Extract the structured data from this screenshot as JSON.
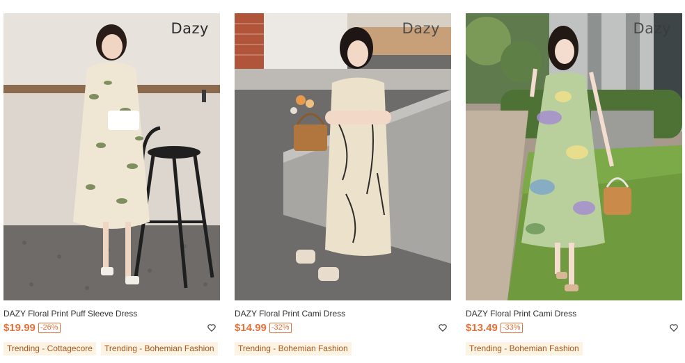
{
  "products": [
    {
      "brand_mark": "Dazy",
      "title": "DAZY Floral Print Puff Sleeve Dress",
      "price": "$19.99",
      "discount": "-26%",
      "tags": [
        "Trending - Cottagecore",
        "Trending - Bohemian Fashion"
      ],
      "wishlist_icon": "heart-outline-icon"
    },
    {
      "brand_mark": "Dazy",
      "title": "DAZY Floral Print Cami Dress",
      "price": "$14.99",
      "discount": "-32%",
      "tags": [
        "Trending - Bohemian Fashion"
      ],
      "wishlist_icon": "heart-outline-icon"
    },
    {
      "brand_mark": "Dazy",
      "title": "DAZY Floral Print Cami Dress",
      "price": "$13.49",
      "discount": "-33%",
      "tags": [
        "Trending - Bohemian Fashion"
      ],
      "wishlist_icon": "heart-outline-icon"
    }
  ],
  "colors": {
    "price": "#e4713a",
    "tag_bg": "#fdf3e3",
    "tag_text": "#a8561c"
  }
}
